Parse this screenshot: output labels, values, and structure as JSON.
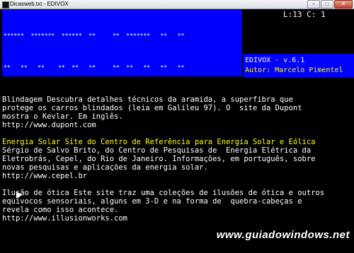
{
  "window": {
    "title": "Dicasweb.txt - EDIVOX",
    "buttons": {
      "minimize": "–",
      "maximize": "□",
      "close": "✕"
    }
  },
  "banner": {
    "lines": [
      "******  *******  ******  **     **  *******   **   **",
      "**   **   **    **  **   **     **  **   **   **   **",
      "**   **   **    **  **   **     **  **   **    ** **",
      "*****   **    ******   **   **  **  **   **     ***",
      "**      **    **       ** **    ** **   **     ** **",
      "**      **    **  **    ***     ***     **   **   **",
      "****** *******   ******     *      ******   **   **"
    ]
  },
  "status": {
    "text": "L:13 C: 1"
  },
  "info": {
    "version": "EDIVOX - v.6.1",
    "author": "Autor: Marcelo Pimentel"
  },
  "document": {
    "p1": [
      "Blindagem Descubra detalhes técnicos da aramida, a superfibra que",
      "protege os carros blindados (leia em Galileu 97). O  site da Dupont",
      "mostra o Kevlar. Em inglês.",
      "http://www.dupont.com"
    ],
    "p2_heading": "Energia Solar Site do Centro de Referência para Energia Solar e Eólica",
    "p2": [
      "Sérgio de Salvo Brito, do Centro de Pesquisas de  Energia Elétrica da",
      "Eletrobrás, Cepel, do Rio de Janeiro. Informações, em português, sobre",
      "novas pesquisas e aplicações da energia solar.",
      "http://www.cepel.br"
    ],
    "p3": [
      "Ilusão de ótica Este site traz uma coleções de ilusões de ótica e outros",
      "equívocos sensoriais, alguns em 3-D e na forma de  quebra-cabeças e",
      "revela como isso acontece.",
      "http://www.illusionworks.com"
    ]
  },
  "watermark": "www.guiadowindows.net"
}
